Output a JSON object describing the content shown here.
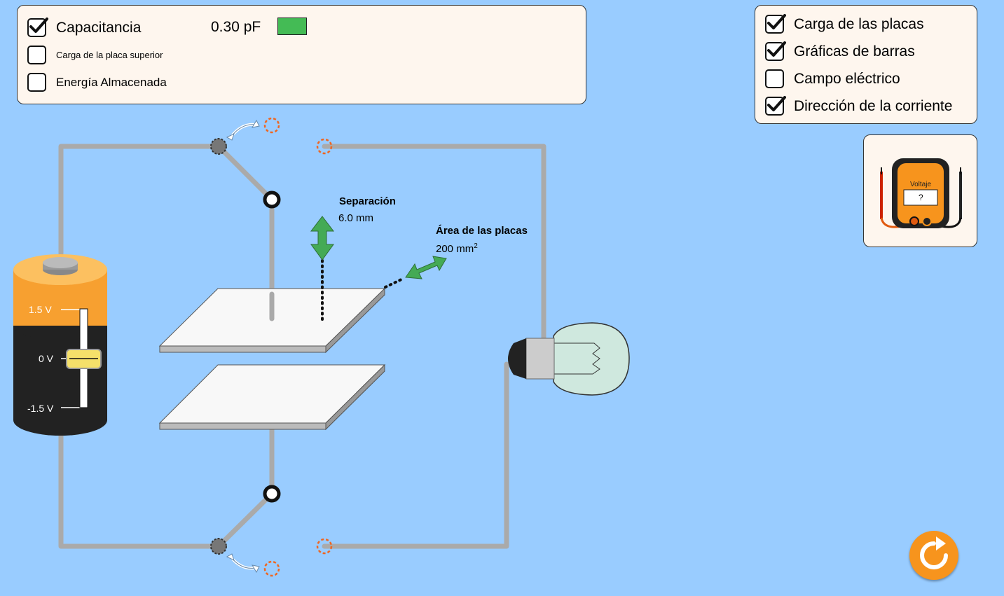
{
  "left_panel": {
    "capacitance": {
      "label": "Capacitancia",
      "value": "0.30 pF",
      "checked": true
    },
    "top_plate_charge": {
      "label": "Carga de la placa superior",
      "checked": false
    },
    "stored_energy": {
      "label": "Energía Almacenada",
      "checked": false
    },
    "capacitance_bar_color": "#44bb55"
  },
  "right_panel": {
    "items": [
      {
        "label": "Carga de las placas",
        "checked": true
      },
      {
        "label": "Gráficas de barras",
        "checked": true
      },
      {
        "label": "Campo eléctrico",
        "checked": false
      },
      {
        "label": "Dirección de la corriente",
        "checked": true
      }
    ]
  },
  "voltmeter": {
    "label": "Voltaje",
    "reading": "?"
  },
  "battery": {
    "ticks": [
      "1.5 V",
      "0 V",
      "-1.5 V"
    ],
    "voltage_fraction": 0.5
  },
  "separation": {
    "label": "Separación",
    "value": "6.0 mm"
  },
  "area": {
    "label": "Área de las placas",
    "value": "200 mm",
    "unit_exponent": "2"
  },
  "colors": {
    "background": "#99ccff",
    "wire": "#aaaaaa",
    "arrow_green": "#44aa55",
    "reset_orange": "#f7941d"
  }
}
